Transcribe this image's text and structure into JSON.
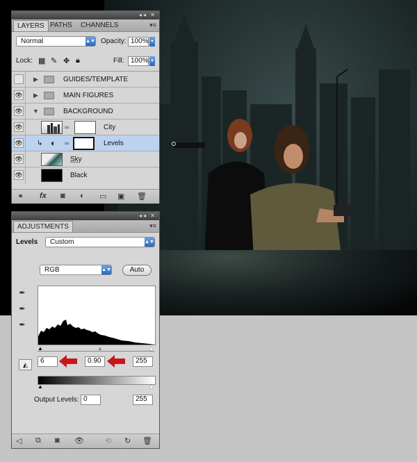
{
  "layers_panel": {
    "tabs": [
      "LAYERS",
      "PATHS",
      "CHANNELS"
    ],
    "blend_mode": "Normal",
    "opacity_label": "Opacity:",
    "opacity_value": "100%",
    "lock_label": "Lock:",
    "fill_label": "Fill:",
    "fill_value": "100%",
    "layers": [
      {
        "name": "GUIDES/TEMPLATE"
      },
      {
        "name": "MAIN FIGURES"
      },
      {
        "name": "BACKGROUND"
      },
      {
        "name": "City"
      },
      {
        "name": "Levels"
      },
      {
        "name": "Sky"
      },
      {
        "name": "Black"
      }
    ]
  },
  "adjustments_panel": {
    "tab": "ADJUSTMENTS",
    "levels_label": "Levels",
    "preset_value": "Custom",
    "channel_value": "RGB",
    "auto_label": "Auto",
    "input_black": "6",
    "input_gamma": "0.90",
    "input_white": "255",
    "output_label": "Output Levels:",
    "output_black": "0",
    "output_white": "255"
  },
  "colors": {
    "annotation_arrow": "#c8161d",
    "selection": "#bcd3f0",
    "accent_blue": "#2a68c0"
  }
}
